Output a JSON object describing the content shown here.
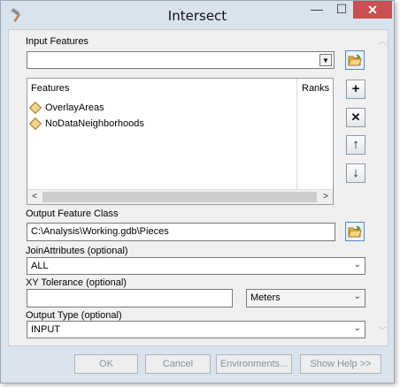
{
  "window": {
    "title": "Intersect",
    "minimize_glyph": "—",
    "maximize_glyph": "☐",
    "close_glyph": "✕"
  },
  "input_features": {
    "label": "Input Features",
    "value": "",
    "table": {
      "columns": [
        "Features",
        "Ranks"
      ],
      "rows": [
        {
          "feature": "OverlayAreas",
          "rank": ""
        },
        {
          "feature": "NoDataNeighborhoods",
          "rank": ""
        }
      ]
    },
    "side_buttons": {
      "add": "+",
      "remove": "✕",
      "up": "↑",
      "down": "↓"
    }
  },
  "output_feature_class": {
    "label": "Output Feature Class",
    "value": "C:\\Analysis\\Working.gdb\\Pieces"
  },
  "join_attributes": {
    "label": "JoinAttributes (optional)",
    "value": "ALL"
  },
  "xy_tolerance": {
    "label": "XY Tolerance (optional)",
    "value": "",
    "unit": "Meters"
  },
  "output_type": {
    "label": "Output Type (optional)",
    "value": "INPUT"
  },
  "buttons": {
    "ok": "OK",
    "cancel": "Cancel",
    "environments": "Environments...",
    "show_help": "Show Help >>"
  },
  "icons": {
    "app": "hammer-icon",
    "browse": "folder-open-icon",
    "feature_layer": "polygon-layer-icon"
  },
  "colors": {
    "title_bar": "#d9e3ee",
    "close_button": "#c75050",
    "client_bg": "#f0f0f0"
  }
}
